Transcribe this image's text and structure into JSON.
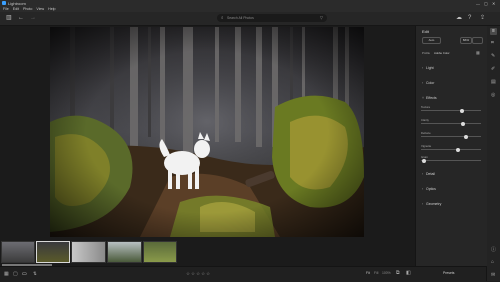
{
  "app": {
    "title": "Lightroom"
  },
  "menu": [
    "File",
    "Edit",
    "Photo",
    "View",
    "Help"
  ],
  "search": {
    "placeholder": "Search All Photos"
  },
  "panel": {
    "title": "Edit",
    "auto_label": "Auto",
    "bw_label": "B&W",
    "profile_label": "Profile",
    "profile_value": "Adobe Color",
    "sections": {
      "light": "Light",
      "color": "Color",
      "effects": "Effects",
      "detail": "Detail",
      "optics": "Optics",
      "geometry": "Geometry"
    },
    "effects_sliders": [
      {
        "label": "Texture",
        "value": 0.7
      },
      {
        "label": "Clarity",
        "value": 0.72
      },
      {
        "label": "Dehaze",
        "value": 0.76
      },
      {
        "label": "Vignette",
        "value": 0.62
      },
      {
        "label": "Grain",
        "value": 0.02
      }
    ]
  },
  "bottom": {
    "fit_label": "Fit",
    "zoom_label": "Fill",
    "zoom_pct": "100%",
    "presets_label": "Presets",
    "rating_text": "☆☆☆☆☆",
    "stars": 0
  }
}
